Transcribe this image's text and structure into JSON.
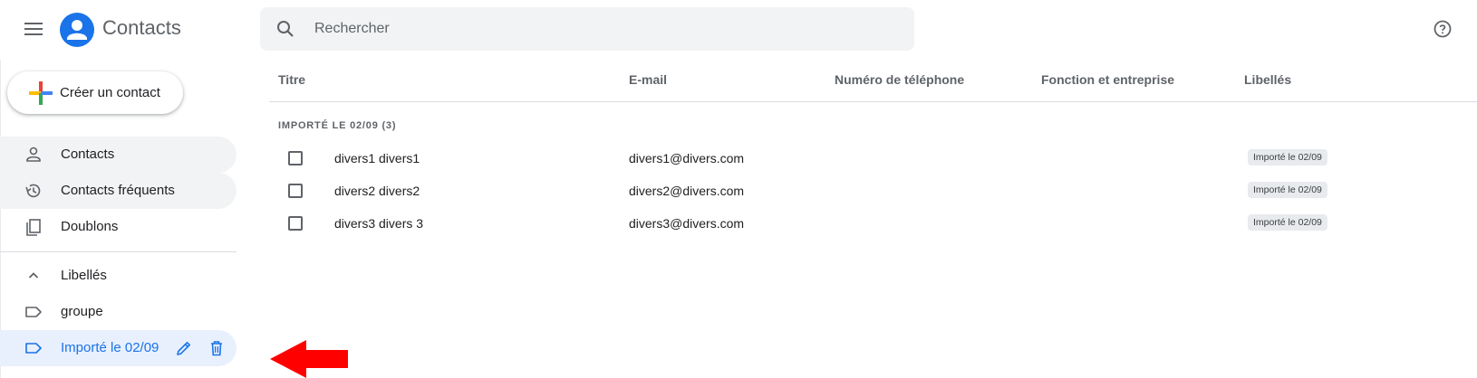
{
  "header": {
    "app_title": "Contacts",
    "search_placeholder": "Rechercher",
    "icons": {
      "menu": "menu-icon",
      "logo": "person-circle-icon",
      "search": "search-icon",
      "help": "help-circle-icon"
    }
  },
  "sidebar": {
    "create_button": "Créer un contact",
    "items": [
      {
        "label": "Contacts",
        "icon": "person-icon"
      },
      {
        "label": "Contacts fréquents",
        "icon": "history-icon"
      },
      {
        "label": "Doublons",
        "icon": "copy-icon"
      }
    ],
    "labels_section": {
      "title": "Libellés",
      "icon": "chevron-up-icon"
    },
    "labels": [
      {
        "label": "groupe",
        "icon": "label-icon"
      },
      {
        "label": "Importé le 02/09",
        "icon": "label-icon",
        "active": true,
        "actions": [
          "edit-icon",
          "delete-icon"
        ]
      }
    ]
  },
  "table": {
    "headers": [
      "Titre",
      "E-mail",
      "Numéro de téléphone",
      "Fonction et entreprise",
      "Libellés"
    ],
    "group_title": "IMPORTÉ LE 02/09 (3)",
    "rows": [
      {
        "name": "divers1 divers1",
        "email": "divers1@divers.com",
        "label": "Importé le 02/09"
      },
      {
        "name": "divers2 divers2",
        "email": "divers2@divers.com",
        "label": "Importé le 02/09"
      },
      {
        "name": "divers3 divers 3",
        "email": "divers3@divers.com",
        "label": "Importé le 02/09"
      }
    ]
  },
  "colors": {
    "accent": "#1a73e8",
    "annotation_arrow": "#ff0000",
    "active_bg": "#e8f0fe",
    "hover_bg": "#f1f3f4"
  }
}
